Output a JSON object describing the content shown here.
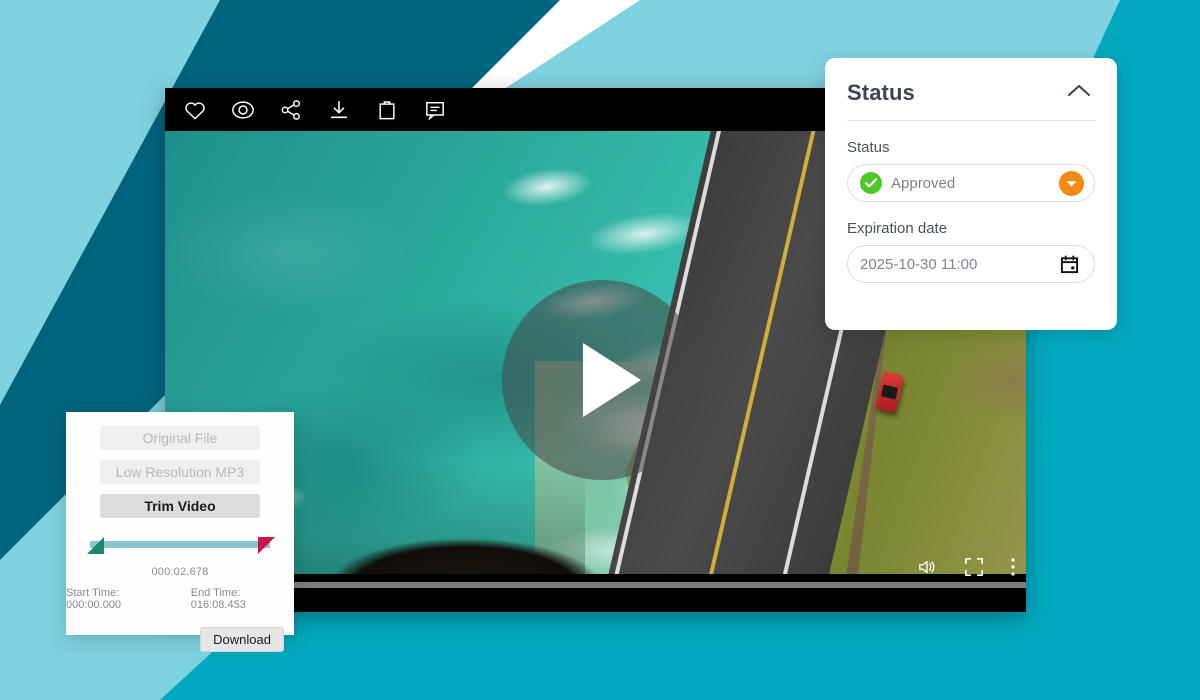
{
  "colors": {
    "bg_light_blue": "#7FD2E0",
    "bg_cyan": "#00A9BF",
    "bg_teal_dark": "#00647F",
    "accent_orange": "#F28A12",
    "status_green": "#4EC72A",
    "trim_start_handle": "#168B6B",
    "trim_end_handle": "#C9174A",
    "trim_track": "#87C5CE"
  },
  "player": {
    "toolbar_icons": [
      {
        "name": "favorite-icon",
        "label": "Favorite"
      },
      {
        "name": "preview-eye-icon",
        "label": "Preview"
      },
      {
        "name": "share-icon",
        "label": "Share"
      },
      {
        "name": "download-icon",
        "label": "Download"
      },
      {
        "name": "add-to-basket-icon",
        "label": "Add to basket"
      },
      {
        "name": "comment-icon",
        "label": "Comment"
      }
    ],
    "play_button_label": "Play",
    "controls": [
      {
        "name": "volume-icon",
        "label": "Volume"
      },
      {
        "name": "fullscreen-icon",
        "label": "Fullscreen"
      },
      {
        "name": "more-options-icon",
        "label": "More options"
      }
    ]
  },
  "status_card": {
    "title": "Status",
    "collapse_icon": "chevron-up-icon",
    "status_field": {
      "label": "Status",
      "value": "Approved",
      "state_icon": "check-circle-icon",
      "dropdown_icon": "chevron-down-icon"
    },
    "expiration_field": {
      "label": "Expiration date",
      "value": "2025-10-30 11:00",
      "icon": "calendar-icon"
    }
  },
  "trim_panel": {
    "buttons": [
      {
        "label": "Original File",
        "state": "disabled"
      },
      {
        "label": "Low Resolution MP3",
        "state": "disabled"
      },
      {
        "label": "Trim Video",
        "state": "active"
      }
    ],
    "current_time": "000:02,678",
    "start_time": "Start Time: 000:00.000",
    "end_time": "End Time: 016:08.453",
    "download_label": "Download"
  }
}
